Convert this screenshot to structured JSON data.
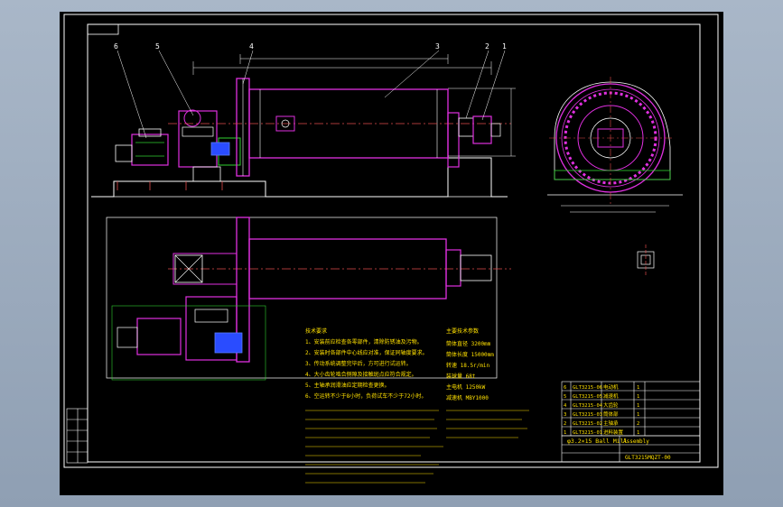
{
  "drawing": {
    "title_block": {
      "drawing_title": "φ3.2×15 Ball Mill",
      "drawing_no": "GLT3215MQZT-00",
      "project_label": "Assembly"
    },
    "part_callouts": [
      "1",
      "2",
      "3",
      "4",
      "5",
      "6"
    ],
    "notes": {
      "heading": "技术要求",
      "lines": [
        "1、安装前应检查各零部件，清除防锈油及污物。",
        "2、安装时各部件中心线应对准，保证同轴度要求。",
        "3、传动系统调整完毕后，方可进行试运转。",
        "4、大小齿轮啮合侧隙及接触斑点应符合规定。",
        "5、主轴承润滑油应定期检查更换。",
        "6、空运转不少于8小时，负荷试车不少于72小时。"
      ]
    },
    "specs": {
      "heading": "主要技术参数",
      "lines": [
        "筒体直径 3200mm",
        "筒体长度 15000mm",
        "转速 18.5r/min",
        "装球量 68t",
        "主电机 1250kW",
        "减速机 MBY1000"
      ]
    },
    "parts_table_rows": [
      [
        "6",
        "GLT3215-06",
        "电动机",
        "1"
      ],
      [
        "5",
        "GLT3215-05",
        "减速机",
        "1"
      ],
      [
        "4",
        "GLT3215-04",
        "大齿轮",
        "1"
      ],
      [
        "3",
        "GLT3215-03",
        "筒体部",
        "1"
      ],
      [
        "2",
        "GLT3215-02",
        "主轴承",
        "2"
      ],
      [
        "1",
        "GLT3215-01",
        "进料装置",
        "1"
      ]
    ]
  }
}
